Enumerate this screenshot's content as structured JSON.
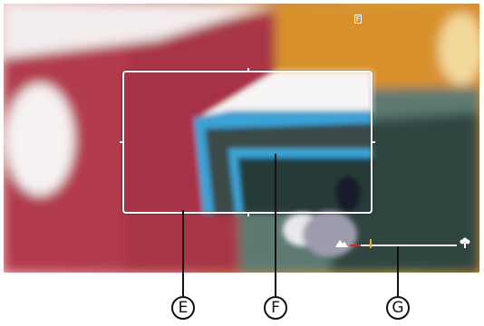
{
  "viewfinder": {
    "description_icon": "manual-focus-icon",
    "focus_scale": {
      "near_icon": "mountain-icon",
      "far_icon": "flower-icon",
      "marker_position_fraction": 0.19
    }
  },
  "callouts": [
    {
      "label": "E"
    },
    {
      "label": "F"
    },
    {
      "label": "G"
    }
  ]
}
